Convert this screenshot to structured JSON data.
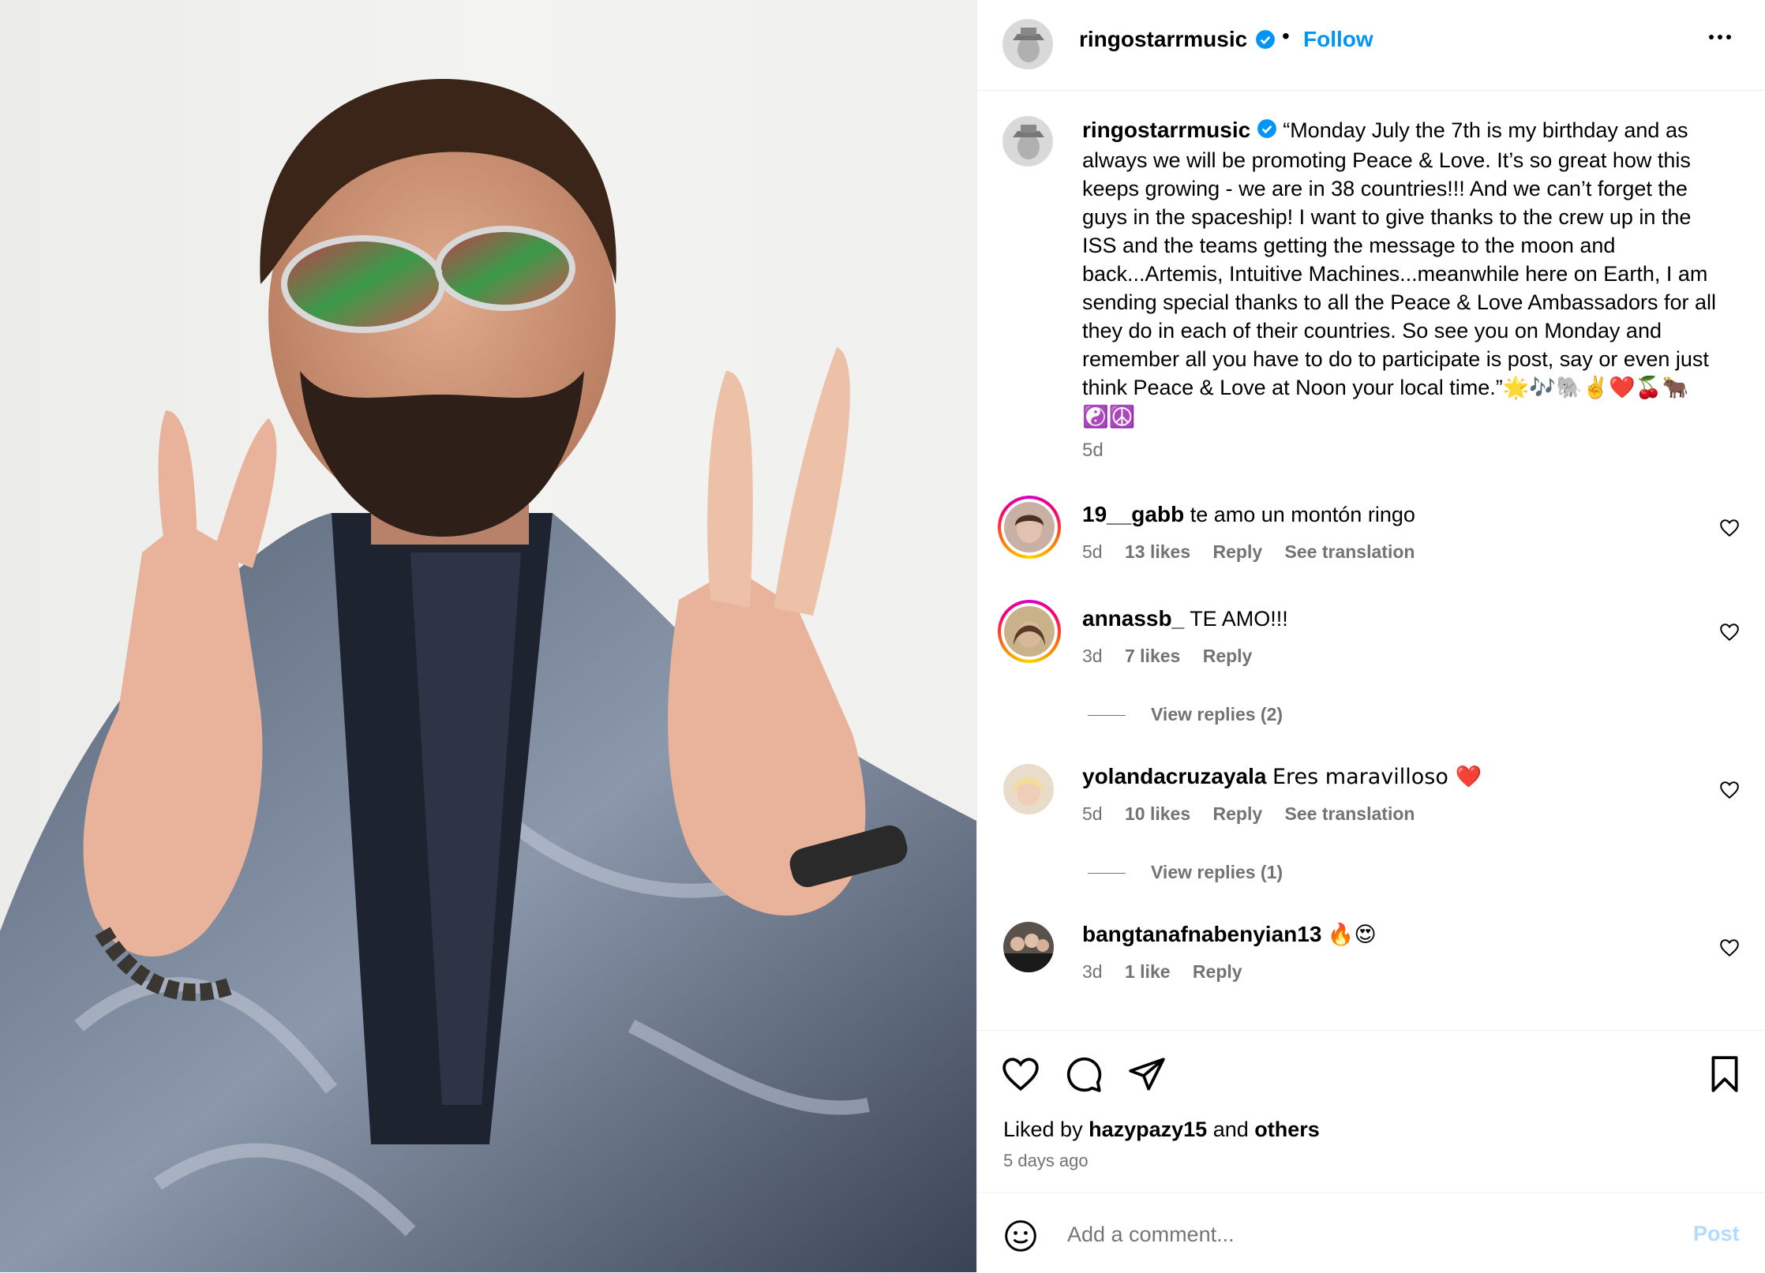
{
  "header": {
    "username": "ringostarrmusic",
    "separator": "•",
    "follow_label": "Follow",
    "more_label": "•••"
  },
  "caption": {
    "username": "ringostarrmusic",
    "text": "“Monday July the 7th is my birthday and as always we will be promoting Peace & Love. It’s so great how this keeps growing - we are in 38 countries!!! And we can’t forget the guys in the spaceship! I want to give thanks to the crew up in the ISS and the teams getting the message to the moon and back...Artemis, Intuitive Machines...meanwhile here on Earth, I am sending special thanks to all the Peace & Love Ambassadors for all they do in each of their countries. So see you on Monday and remember all you have to do to participate is post, say or even just think Peace & Love at Noon your local time.”",
    "emojis": "🌟🎶🐘✌️❤️🍒🐂☯️☮️",
    "time": "5d"
  },
  "comments": [
    {
      "username": "19__gabb",
      "text": "te amo un montón ringo",
      "time": "5d",
      "likes": "13 likes",
      "reply": "Reply",
      "translate": "See translation"
    },
    {
      "username": "annassb_",
      "text": "TE AMO!!!",
      "time": "3d",
      "likes": "7 likes",
      "reply": "Reply",
      "view_replies": "View replies (2)"
    },
    {
      "username": "yolandacruzayala",
      "text": "Eres maravilloso ❤️",
      "time": "5d",
      "likes": "10 likes",
      "reply": "Reply",
      "translate": "See translation",
      "view_replies": "View replies (1)"
    },
    {
      "username": "bangtanafnabenyian13",
      "text": "🔥😍",
      "time": "3d",
      "likes": "1 like",
      "reply": "Reply"
    }
  ],
  "footer": {
    "liked_by_prefix": "Liked by",
    "liked_by_user": "hazypazy15",
    "liked_by_and": "and",
    "liked_by_others": "others",
    "date": "5 days ago"
  },
  "add_comment": {
    "placeholder": "Add a comment...",
    "post_label": "Post"
  },
  "colors": {
    "accent": "#0095f6",
    "verified": "#0095f6",
    "muted": "#737373",
    "post_disabled": "#b3dbff"
  },
  "icons": [
    "verified-badge-icon",
    "more-icon",
    "heart-icon",
    "comment-icon",
    "share-icon",
    "save-icon",
    "emoji-icon"
  ]
}
